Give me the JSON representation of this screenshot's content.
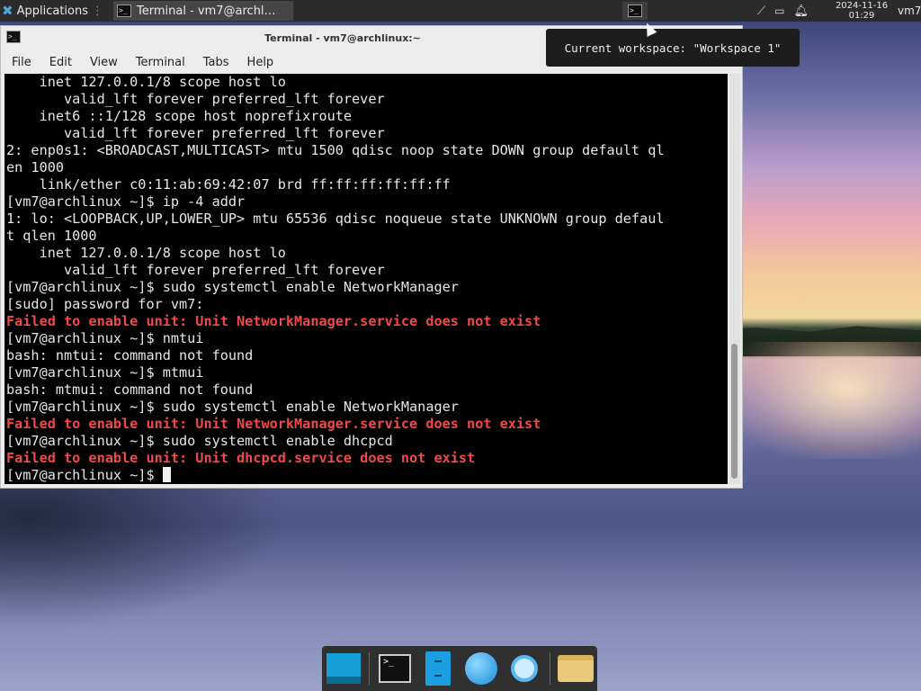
{
  "panel": {
    "applications_label": "Applications",
    "task_label": "Terminal - vm7@archl…",
    "clock_date": "2024-11-16",
    "clock_time": "01:29",
    "user": "vm7",
    "tray_icons": [
      "network-disconnected-icon",
      "battery-icon",
      "notification-bell-icon"
    ]
  },
  "tooltip": {
    "text": "Current workspace: \"Workspace 1\""
  },
  "window": {
    "title": "Terminal - vm7@archlinux:~",
    "menu": [
      "File",
      "Edit",
      "View",
      "Terminal",
      "Tabs",
      "Help"
    ]
  },
  "terminal": {
    "lines": [
      {
        "text": "    inet 127.0.0.1/8 scope host lo",
        "error": false
      },
      {
        "text": "       valid_lft forever preferred_lft forever",
        "error": false
      },
      {
        "text": "    inet6 ::1/128 scope host noprefixroute",
        "error": false
      },
      {
        "text": "       valid_lft forever preferred_lft forever",
        "error": false
      },
      {
        "text": "2: enp0s1: <BROADCAST,MULTICAST> mtu 1500 qdisc noop state DOWN group default ql",
        "error": false
      },
      {
        "text": "en 1000",
        "error": false
      },
      {
        "text": "    link/ether c0:11:ab:69:42:07 brd ff:ff:ff:ff:ff:ff",
        "error": false
      },
      {
        "text": "[vm7@archlinux ~]$ ip -4 addr",
        "error": false
      },
      {
        "text": "1: lo: <LOOPBACK,UP,LOWER_UP> mtu 65536 qdisc noqueue state UNKNOWN group defaul",
        "error": false
      },
      {
        "text": "t qlen 1000",
        "error": false
      },
      {
        "text": "    inet 127.0.0.1/8 scope host lo",
        "error": false
      },
      {
        "text": "       valid_lft forever preferred_lft forever",
        "error": false
      },
      {
        "text": "[vm7@archlinux ~]$ sudo systemctl enable NetworkManager",
        "error": false
      },
      {
        "text": "[sudo] password for vm7:",
        "error": false
      },
      {
        "text": "Failed to enable unit: Unit NetworkManager.service does not exist",
        "error": true
      },
      {
        "text": "[vm7@archlinux ~]$ nmtui",
        "error": false
      },
      {
        "text": "bash: nmtui: command not found",
        "error": false
      },
      {
        "text": "[vm7@archlinux ~]$ mtmui",
        "error": false
      },
      {
        "text": "bash: mtmui: command not found",
        "error": false
      },
      {
        "text": "[vm7@archlinux ~]$ sudo systemctl enable NetworkManager",
        "error": false
      },
      {
        "text": "Failed to enable unit: Unit NetworkManager.service does not exist",
        "error": true
      },
      {
        "text": "[vm7@archlinux ~]$ sudo systemctl enable dhcpcd",
        "error": false
      },
      {
        "text": "Failed to enable unit: Unit dhcpcd.service does not exist",
        "error": true
      }
    ],
    "prompt": "[vm7@archlinux ~]$ "
  },
  "dock": {
    "items": [
      "show-desktop-icon",
      "terminal-icon",
      "file-cabinet-icon",
      "web-browser-globe-icon",
      "app-finder-search-icon",
      "home-folder-icon"
    ]
  }
}
